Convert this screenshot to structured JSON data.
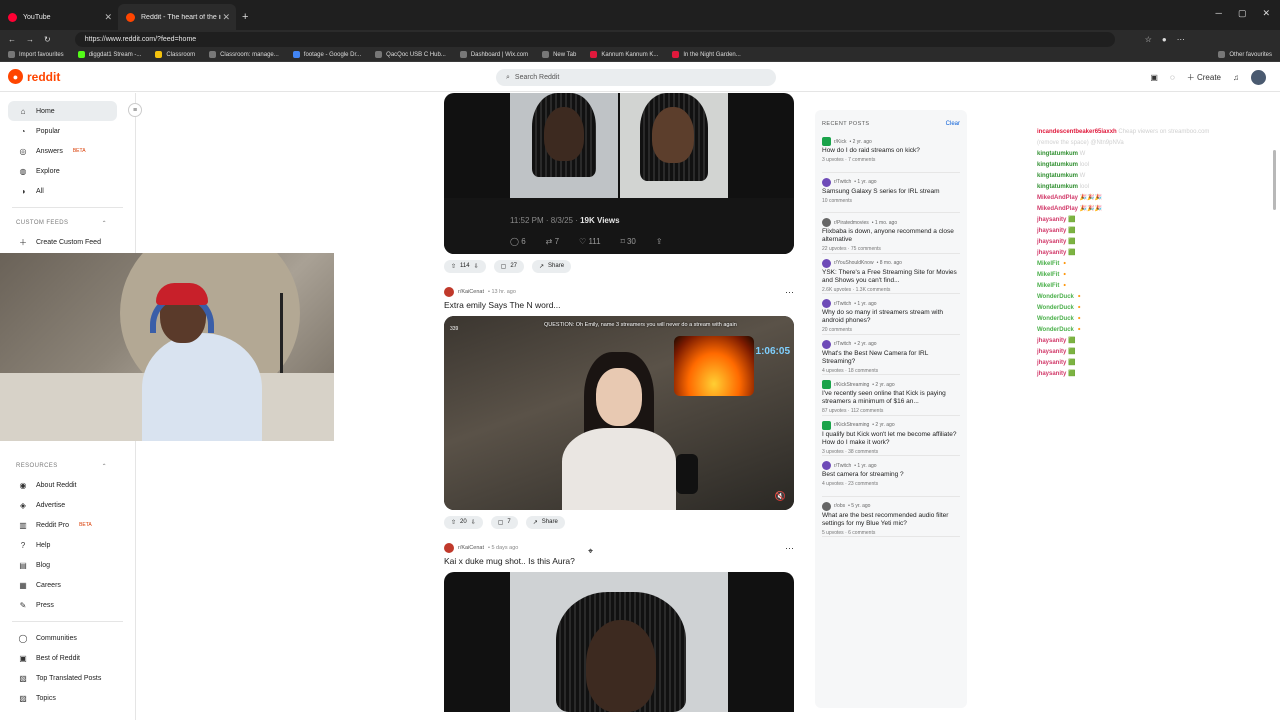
{
  "browser": {
    "tabs": [
      {
        "label": "YouTube",
        "active": false
      },
      {
        "label": "Reddit - The heart of the internet",
        "active": true
      }
    ],
    "url": "https://www.reddit.com/?feed=home",
    "bookmarks": [
      "Import favourites",
      "diggdat1 Stream -...",
      "Classroom",
      "Classroom: manage...",
      "footage - Google Dr...",
      "QacQoc USB C Hub...",
      "Dashboard | Wix.com",
      "New Tab",
      "Kannum Kannum K...",
      "In the Night Garden..."
    ],
    "other_bookmarks": "Other favourites"
  },
  "reddit": {
    "logo_text": "reddit",
    "search_placeholder": "Search Reddit",
    "create_label": "Create"
  },
  "leftnav": {
    "main": [
      {
        "label": "Home",
        "icon": "home-icon"
      },
      {
        "label": "Popular",
        "icon": "popular-icon"
      },
      {
        "label": "Answers",
        "icon": "answers-icon",
        "badge": "BETA"
      },
      {
        "label": "Explore",
        "icon": "explore-icon"
      },
      {
        "label": "All",
        "icon": "all-icon"
      }
    ],
    "custom_feeds_header": "CUSTOM FEEDS",
    "create_custom_feed": "Create Custom Feed",
    "resources_header": "RESOURCES",
    "resources": [
      {
        "label": "About Reddit"
      },
      {
        "label": "Advertise"
      },
      {
        "label": "Reddit Pro",
        "badge": "BETA"
      },
      {
        "label": "Help"
      },
      {
        "label": "Blog"
      },
      {
        "label": "Careers"
      },
      {
        "label": "Press"
      }
    ],
    "more": [
      {
        "label": "Communities"
      },
      {
        "label": "Best of Reddit"
      },
      {
        "label": "Top Translated Posts"
      },
      {
        "label": "Topics"
      }
    ]
  },
  "feed": {
    "post0": {
      "tweet_time": "11:52 PM · 8/3/25 · ",
      "tweet_views": "19K Views",
      "tweet_replies": "6",
      "tweet_reposts": "7",
      "tweet_likes": "111",
      "tweet_bookmarks": "30",
      "upvotes": "114",
      "comments": "27",
      "share": "Share"
    },
    "post1": {
      "subreddit": "r/KaiCenat",
      "time": "• 13 hr. ago",
      "title": "Extra emily Says The N word...",
      "stream_question": "QUESTION: Oh Emily, name 3 streamers you will never do a stream with again",
      "stream_timer": "1:06:05",
      "stream_viewers": "339",
      "upvotes": "20",
      "comments": "7",
      "share": "Share"
    },
    "post2": {
      "subreddit": "r/KaiCenat",
      "time": "• 5 days ago",
      "title": "Kai x duke mug shot.. Is this Aura?"
    }
  },
  "recent": {
    "header": "RECENT POSTS",
    "clear": "Clear",
    "items": [
      {
        "sub": "r/Kick",
        "time": "• 2 yr. ago",
        "title": "How do I do raid streams on kick?",
        "stats": "3 upvotes · 7 comments",
        "icon": "kick"
      },
      {
        "sub": "r/Twitch",
        "time": "• 1 yr. ago",
        "title": "Samsung Galaxy S series for IRL stream",
        "stats": "10 comments",
        "icon": "twitch"
      },
      {
        "sub": "r/Piratedmovies",
        "time": "• 1 mo. ago",
        "title": "Flixbaba is down, anyone recommend a close alternative",
        "stats": "22 upvotes · 75 comments",
        "icon": "gray"
      },
      {
        "sub": "r/YouShouldKnow",
        "time": "• 8 mo. ago",
        "title": "YSK: There's a Free Streaming Site for Movies and Shows you can't find...",
        "stats": "2.6K upvotes · 1.3K comments",
        "icon": "twitch"
      },
      {
        "sub": "r/Twitch",
        "time": "• 1 yr. ago",
        "title": "Why do so many irl streamers stream with android phones?",
        "stats": "20 comments",
        "icon": "twitch"
      },
      {
        "sub": "r/Twitch",
        "time": "• 2 yr. ago",
        "title": "What's the Best New Camera for IRL Streaming?",
        "stats": "4 upvotes · 18 comments",
        "icon": "twitch"
      },
      {
        "sub": "r/KickStreaming",
        "time": "• 2 yr. ago",
        "title": "I've recently seen online that Kick is paying streamers a minimum of $16 an...",
        "stats": "87 upvotes · 112 comments",
        "icon": "kick"
      },
      {
        "sub": "r/KickStreaming",
        "time": "• 2 yr. ago",
        "title": "I qualify but Kick won't let me become affiliate? How do I make it work?",
        "stats": "3 upvotes · 38 comments",
        "icon": "kick"
      },
      {
        "sub": "r/Twitch",
        "time": "• 1 yr. ago",
        "title": "Best camera for streaming ?",
        "stats": "4 upvotes · 23 comments",
        "icon": "twitch"
      },
      {
        "sub": "r/obs",
        "time": "• 5 yr. ago",
        "title": "What are the best recommended audio filter settings for my Blue Yeti mic?",
        "stats": "5 upvotes · 6 comments",
        "icon": "gray"
      }
    ]
  },
  "chat": [
    {
      "user": "incandescentbeaker65iaxxh",
      "color": "#e0193c",
      "msg": " Cheap viewers on streamboo.com"
    },
    {
      "user": "",
      "color": "#888",
      "msg": "(remove the space) @Ntn9pNVa"
    },
    {
      "user": "kingtatumkum",
      "color": "#2f8f2f",
      "msg": " W"
    },
    {
      "user": "kingtatumkum",
      "color": "#2f8f2f",
      "msg": " lool"
    },
    {
      "user": "kingtatumkum",
      "color": "#2f8f2f",
      "msg": " W"
    },
    {
      "user": "kingtatumkum",
      "color": "#2f8f2f",
      "msg": " lool"
    },
    {
      "user": "MikedAndPlay",
      "color": "#d23a6a",
      "msg": " 🎉🎉🎉"
    },
    {
      "user": "MikedAndPlay",
      "color": "#d23a6a",
      "msg": " 🎉🎉🎉"
    },
    {
      "user": "jhaysanity",
      "color": "#d23a6a",
      "msg": " 🟩"
    },
    {
      "user": "jhaysanity",
      "color": "#d23a6a",
      "msg": " 🟩"
    },
    {
      "user": "jhaysanity",
      "color": "#d23a6a",
      "msg": " 🟩"
    },
    {
      "user": "jhaysanity",
      "color": "#d23a6a",
      "msg": " 🟩"
    },
    {
      "user": "MikelFit",
      "color": "#4bb04b",
      "msg": " 🔸"
    },
    {
      "user": "MikelFit",
      "color": "#4bb04b",
      "msg": " 🔸"
    },
    {
      "user": "MikelFit",
      "color": "#4bb04b",
      "msg": " 🔸"
    },
    {
      "user": "WonderDuck",
      "color": "#4bb04b",
      "msg": " 🔸"
    },
    {
      "user": "WonderDuck",
      "color": "#4bb04b",
      "msg": " 🔸"
    },
    {
      "user": "WonderDuck",
      "color": "#4bb04b",
      "msg": " 🔸"
    },
    {
      "user": "WonderDuck",
      "color": "#4bb04b",
      "msg": " 🔸"
    },
    {
      "user": "jhaysanity",
      "color": "#d23a6a",
      "msg": " 🟩"
    },
    {
      "user": "jhaysanity",
      "color": "#d23a6a",
      "msg": " 🟩"
    },
    {
      "user": "jhaysanity",
      "color": "#d23a6a",
      "msg": " 🟩"
    },
    {
      "user": "jhaysanity",
      "color": "#d23a6a",
      "msg": " 🟩"
    }
  ],
  "colors": {
    "reddit_orange": "#ff4500",
    "link_blue": "#0a5fd8",
    "beta_red": "#d93a00"
  }
}
